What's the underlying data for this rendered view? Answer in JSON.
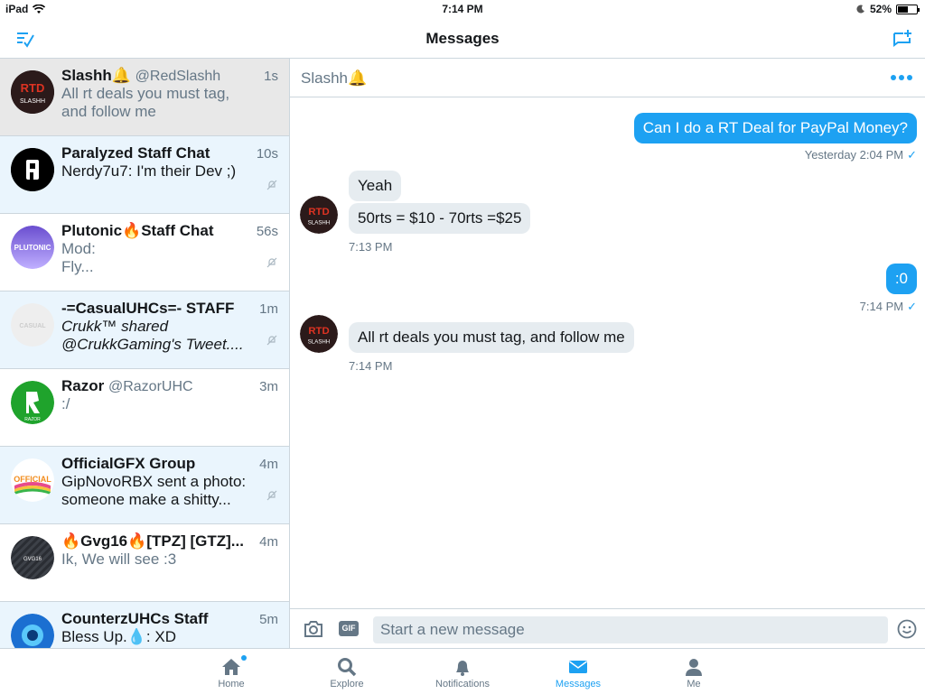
{
  "status_bar": {
    "device": "iPad",
    "time": "7:14 PM",
    "battery": "52%",
    "battery_level": 0.52
  },
  "header": {
    "title": "Messages"
  },
  "conversations": [
    {
      "name": "Slashh🔔",
      "handle": "@RedSlashh",
      "time": "1s",
      "preview": "All rt deals you must tag, and follow me",
      "muted": false,
      "state": "selected"
    },
    {
      "name": "Paralyzed Staff Chat",
      "handle": "",
      "time": "10s",
      "preview": "Nerdy7u7: I'm their Dev  ;)",
      "muted": true,
      "state": "unread"
    },
    {
      "name": "Plutonic🔥Staff Chat",
      "handle": "",
      "time": "56s",
      "preview_line1": "Mod:",
      "preview_line2": "Fly...",
      "muted": true,
      "state": "read"
    },
    {
      "name": "-=CasualUHCs=- STAFF",
      "handle": "",
      "time": "1m",
      "preview": "Crukk™ shared @CrukkGaming's Tweet....",
      "muted": true,
      "state": "unread"
    },
    {
      "name": "Razor",
      "handle": "@RazorUHC",
      "time": "3m",
      "preview": ":/",
      "muted": false,
      "state": "read"
    },
    {
      "name": "OfficialGFX Group",
      "handle": "",
      "time": "4m",
      "preview": "GipNovoRBX sent a photo: someone make a shitty...",
      "muted": true,
      "state": "unread"
    },
    {
      "name": "🔥Gvg16🔥[TPZ] [GTZ]...",
      "handle": "",
      "time": "4m",
      "preview": "Ik, We will see :3",
      "muted": false,
      "state": "read"
    },
    {
      "name": "CounterzUHCs Staff",
      "handle": "",
      "time": "5m",
      "preview": "Bless Up.💧: XD",
      "muted": false,
      "state": "unread"
    }
  ],
  "avatars": {
    "slashh": {
      "top": "RTD",
      "bottom": "SLASHH"
    },
    "plutonic": "PLUTONIC",
    "casual": "CASUAL",
    "razor": "RAZOR",
    "officialgfx": "OFFICIAL",
    "gvg": "GVG16"
  },
  "chat": {
    "title": "Slashh🔔",
    "messages": [
      {
        "direction": "out",
        "text": "Can I do a RT Deal for PayPal Money?",
        "meta": "Yesterday 2:04 PM",
        "read_check": "✓"
      },
      {
        "direction": "in",
        "text": "Yeah"
      },
      {
        "direction": "in",
        "text": "50rts = $10 - 70rts =$25",
        "meta": "7:13 PM"
      },
      {
        "direction": "out",
        "text": ":0",
        "meta": "7:14 PM",
        "read_check": "✓"
      },
      {
        "direction": "in",
        "text": "All rt deals you must tag, and follow me",
        "meta": "7:14 PM"
      }
    ],
    "composer": {
      "placeholder": "Start a new message",
      "gif_label": "GIF"
    }
  },
  "tabs": [
    {
      "label": "Home",
      "icon": "home-icon",
      "active": false,
      "badge": true
    },
    {
      "label": "Explore",
      "icon": "search-icon",
      "active": false
    },
    {
      "label": "Notifications",
      "icon": "bell-icon",
      "active": false
    },
    {
      "label": "Messages",
      "icon": "envelope-icon",
      "active": true
    },
    {
      "label": "Me",
      "icon": "person-icon",
      "active": false
    }
  ],
  "colors": {
    "accent": "#1da1f2",
    "unread_bg": "#eaf5fd",
    "selected_bg": "#e8e8e8",
    "incoming_bubble": "#e6ecf0"
  }
}
